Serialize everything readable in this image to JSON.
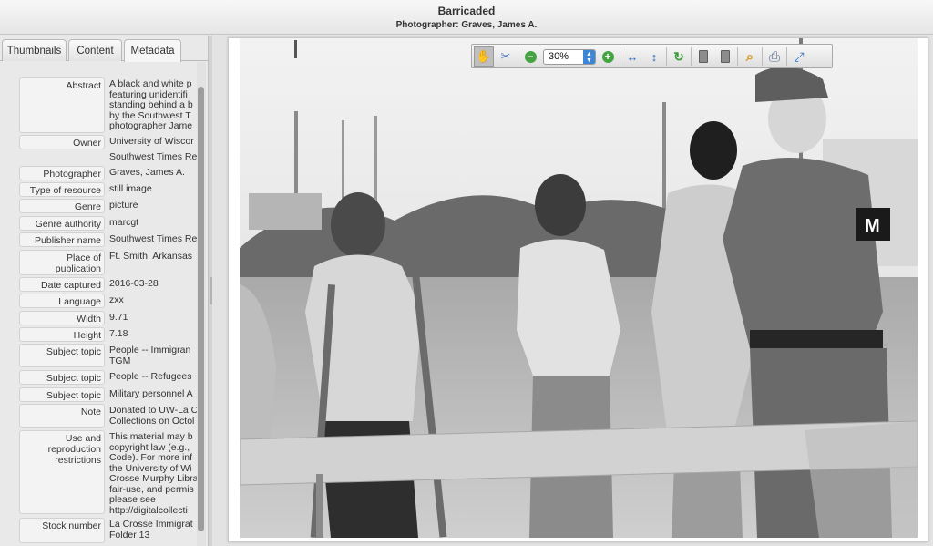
{
  "header": {
    "title": "Barricaded",
    "photographer_label": "Photographer:",
    "photographer_name": "Graves, James A."
  },
  "tabs": [
    {
      "label": "Thumbnails"
    },
    {
      "label": "Content"
    },
    {
      "label": "Metadata",
      "active": true
    }
  ],
  "metadata": [
    {
      "label": "Abstract",
      "value": "A black and white p\nfeaturing unidentifi\nstanding behind a b\nby the Southwest T\nphotographer Jame"
    },
    {
      "label": "Owner",
      "value": "University of Wiscor"
    },
    {
      "label": "",
      "value": "Southwest Times Re"
    },
    {
      "label": "Photographer",
      "value": "Graves, James A."
    },
    {
      "label": "Type of resource",
      "value": "still image"
    },
    {
      "label": "Genre",
      "value": "picture"
    },
    {
      "label": "Genre authority",
      "value": "marcgt"
    },
    {
      "label": "Publisher name",
      "value": "Southwest Times Re"
    },
    {
      "label": "Place of\npublication",
      "value": "Ft. Smith, Arkansas"
    },
    {
      "label": "Date captured",
      "value": "2016-03-28"
    },
    {
      "label": "Language",
      "value": "zxx"
    },
    {
      "label": "Width",
      "value": "9.71"
    },
    {
      "label": "Height",
      "value": "7.18"
    },
    {
      "label": "Subject topic",
      "value": "People -- Immigran\nTGM"
    },
    {
      "label": "Subject topic",
      "value": "People -- Refugees"
    },
    {
      "label": "Subject topic",
      "value": "Military personnel A"
    },
    {
      "label": "Note",
      "value": "Donated to UW-La C\nCollections on Octol"
    },
    {
      "label": "Use and\nreproduction\nrestrictions",
      "value": "This material may b\ncopyright law (e.g.,\nCode). For more inf\nthe University of Wi\nCrosse Murphy Libra\nfair-use, and permis\nplease see\nhttp://digitalcollecti"
    },
    {
      "label": "Stock number",
      "value": "La Crosse Immigrat\nFolder 13"
    }
  ],
  "toolbar": {
    "zoom_value": "30%",
    "buttons": [
      {
        "name": "pan-hand-icon",
        "glyph": "✋",
        "color": "#d88a2a"
      },
      {
        "name": "select-text-icon",
        "glyph": "✂",
        "color": "#4a72b8"
      },
      {
        "name": "zoom-out-icon",
        "glyph": "−",
        "color": "#3e9b3a"
      },
      {
        "name": "zoom-in-icon",
        "glyph": "+",
        "color": "#3e9b3a"
      },
      {
        "name": "fit-width-icon",
        "glyph": "↔",
        "color": "#2f6fc0"
      },
      {
        "name": "fit-height-icon",
        "glyph": "↕",
        "color": "#2f6fc0"
      },
      {
        "name": "rotate-icon",
        "glyph": "↻",
        "color": "#3e9b3a"
      },
      {
        "name": "previous-page-icon",
        "glyph": "▮",
        "color": "#777777"
      },
      {
        "name": "next-page-icon",
        "glyph": "▮",
        "color": "#777777"
      },
      {
        "name": "search-icon",
        "glyph": "⌕",
        "color": "#d49a1e"
      },
      {
        "name": "print-icon",
        "glyph": "⎙",
        "color": "#5a6f8c"
      },
      {
        "name": "fullscreen-icon",
        "glyph": "⤢",
        "color": "#2f6fc0"
      }
    ]
  }
}
